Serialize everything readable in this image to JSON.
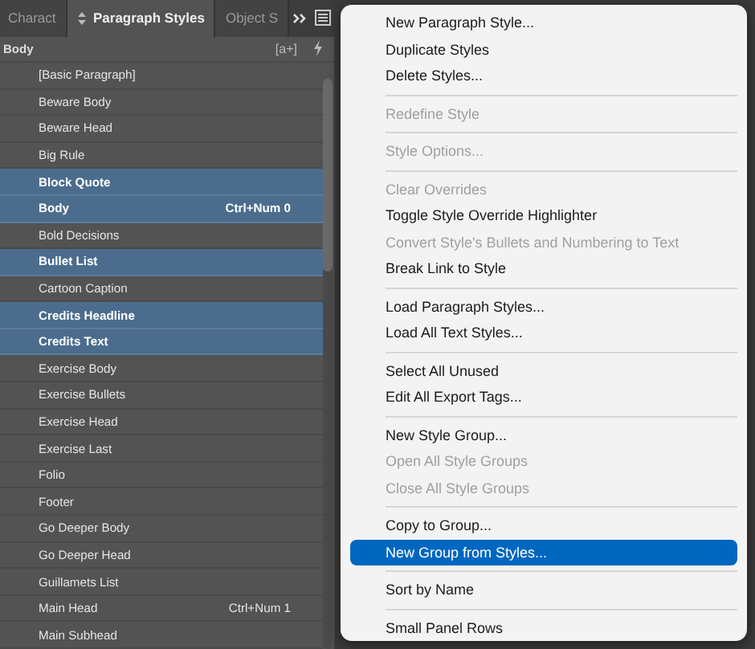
{
  "panel": {
    "tabs": [
      {
        "label": "Charact",
        "selected": false,
        "kind": "plain"
      },
      {
        "label": "Paragraph Styles",
        "selected": true,
        "kind": "styles"
      },
      {
        "label": "Object S",
        "selected": false,
        "kind": "plain"
      }
    ],
    "current_style": "Body",
    "new_style_glyph": "[a+]",
    "styles": [
      {
        "name": "[Basic Paragraph]",
        "selected": false
      },
      {
        "name": "Beware Body",
        "selected": false
      },
      {
        "name": "Beware Head",
        "selected": false
      },
      {
        "name": "Big Rule",
        "selected": false
      },
      {
        "name": "Block Quote",
        "selected": true
      },
      {
        "name": "Body",
        "shortcut": "Ctrl+Num 0",
        "selected": true
      },
      {
        "name": "Bold Decisions",
        "selected": false
      },
      {
        "name": "Bullet List",
        "selected": true
      },
      {
        "name": "Cartoon Caption",
        "selected": false
      },
      {
        "name": "Credits Headline",
        "selected": true
      },
      {
        "name": "Credits Text",
        "selected": true
      },
      {
        "name": "Exercise Body",
        "selected": false
      },
      {
        "name": "Exercise Bullets",
        "selected": false
      },
      {
        "name": "Exercise Head",
        "selected": false
      },
      {
        "name": "Exercise Last",
        "selected": false
      },
      {
        "name": "Folio",
        "selected": false
      },
      {
        "name": "Footer",
        "selected": false
      },
      {
        "name": "Go Deeper Body",
        "selected": false
      },
      {
        "name": "Go Deeper Head",
        "selected": false
      },
      {
        "name": "Guillamets List",
        "selected": false
      },
      {
        "name": "Main Head",
        "shortcut": "Ctrl+Num 1",
        "selected": false
      },
      {
        "name": "Main Subhead",
        "selected": false
      }
    ]
  },
  "menu": {
    "groups": [
      [
        {
          "label": "New Paragraph Style...",
          "disabled": false,
          "selected": false
        },
        {
          "label": "Duplicate Styles",
          "disabled": false,
          "selected": false
        },
        {
          "label": "Delete Styles...",
          "disabled": false,
          "selected": false
        }
      ],
      [
        {
          "label": "Redefine Style",
          "disabled": true,
          "selected": false
        }
      ],
      [
        {
          "label": "Style Options...",
          "disabled": true,
          "selected": false
        }
      ],
      [
        {
          "label": "Clear Overrides",
          "disabled": true,
          "selected": false
        },
        {
          "label": "Toggle Style Override Highlighter",
          "disabled": false,
          "selected": false
        },
        {
          "label": "Convert Style's Bullets and Numbering to Text",
          "disabled": true,
          "selected": false
        },
        {
          "label": "Break Link to Style",
          "disabled": false,
          "selected": false
        }
      ],
      [
        {
          "label": "Load Paragraph Styles...",
          "disabled": false,
          "selected": false
        },
        {
          "label": "Load All Text Styles...",
          "disabled": false,
          "selected": false
        }
      ],
      [
        {
          "label": "Select All Unused",
          "disabled": false,
          "selected": false
        },
        {
          "label": "Edit All Export Tags...",
          "disabled": false,
          "selected": false
        }
      ],
      [
        {
          "label": "New Style Group...",
          "disabled": false,
          "selected": false
        },
        {
          "label": "Open All Style Groups",
          "disabled": true,
          "selected": false
        },
        {
          "label": "Close All Style Groups",
          "disabled": true,
          "selected": false
        }
      ],
      [
        {
          "label": "Copy to Group...",
          "disabled": false,
          "selected": false
        },
        {
          "label": "New Group from Styles...",
          "disabled": false,
          "selected": true
        }
      ],
      [
        {
          "label": "Sort by Name",
          "disabled": false,
          "selected": false
        }
      ],
      [
        {
          "label": "Small Panel Rows",
          "disabled": false,
          "selected": false
        }
      ]
    ]
  }
}
